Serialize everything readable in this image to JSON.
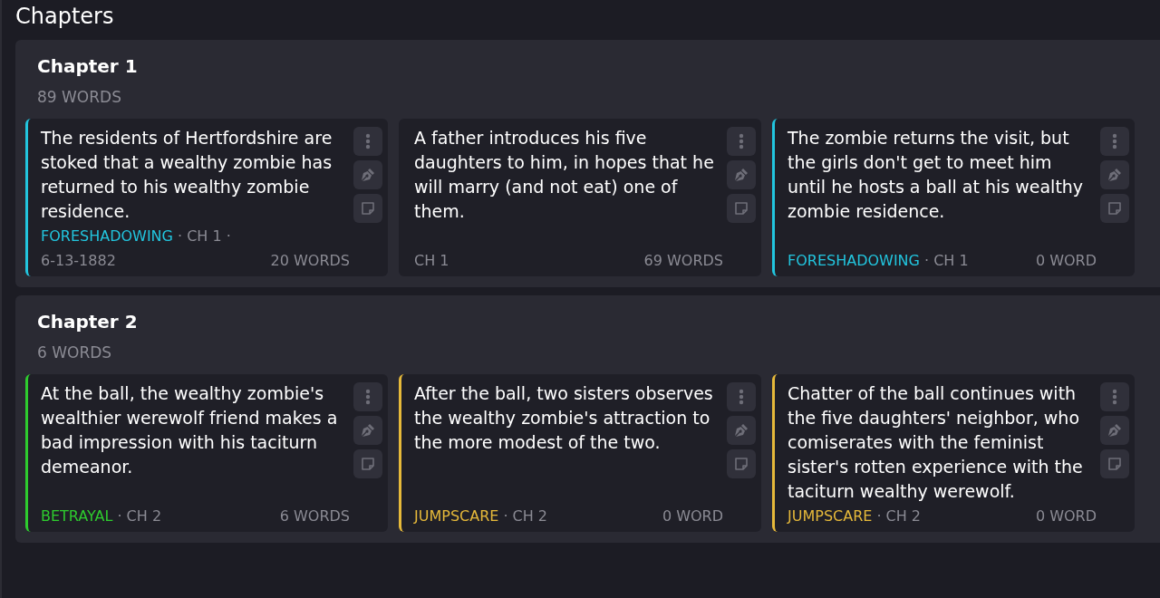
{
  "title": "Chapters",
  "chapters": [
    {
      "name": "Chapter 1",
      "words": "89 WORDS",
      "cards": [
        {
          "text": "The residents of Hertfordshire are stoked that a wealthy zombie has returned to his wealthy zombie residence.",
          "color": "#22c5de",
          "meta": [
            {
              "kind": "tag",
              "text": "FORESHADOWING"
            },
            {
              "kind": "plain",
              "text": "· CH 1 ·"
            },
            {
              "kind": "plain",
              "text": "6-13-1882"
            }
          ],
          "words": "20 WORDS"
        },
        {
          "text": "A father introduces his five daughters to him, in hopes that he will marry (and not eat) one of them.",
          "meta": [
            {
              "kind": "plain",
              "text": "CH 1"
            }
          ],
          "words": "69 WORDS"
        },
        {
          "text": "The zombie returns the visit, but the girls don't get to meet him until he hosts a ball at his wealthy zombie residence.",
          "color": "#22c5de",
          "meta": [
            {
              "kind": "tag",
              "text": "FORESHADOWING"
            },
            {
              "kind": "plain",
              "text": "· CH 1"
            }
          ],
          "words": "0 WORD"
        }
      ]
    },
    {
      "name": "Chapter 2",
      "words": "6 WORDS",
      "cards": [
        {
          "text": "At the ball, the wealthy zombie's wealthier werewolf friend makes a bad impression with his taciturn demeanor.",
          "color": "#2ecc2e",
          "meta": [
            {
              "kind": "tag",
              "text": "BETRAYAL"
            },
            {
              "kind": "plain",
              "text": "· CH 2"
            }
          ],
          "words": "6 WORDS"
        },
        {
          "text": "After the ball, two sisters observes the wealthy zombie's attraction to the more modest of the two.",
          "color": "#e6b93a",
          "meta": [
            {
              "kind": "tag",
              "text": "JUMPSCARE"
            },
            {
              "kind": "plain",
              "text": "· CH 2"
            }
          ],
          "words": "0 WORD"
        },
        {
          "text": "Chatter of the ball continues with the five daughters' neighbor, who comiserates with the feminist sister's rotten experience with the taciturn wealthy werewolf.",
          "color": "#e6b93a",
          "meta": [
            {
              "kind": "tag",
              "text": "JUMPSCARE"
            },
            {
              "kind": "plain",
              "text": "· CH 2"
            }
          ],
          "words": "0 WORD"
        }
      ]
    }
  ]
}
